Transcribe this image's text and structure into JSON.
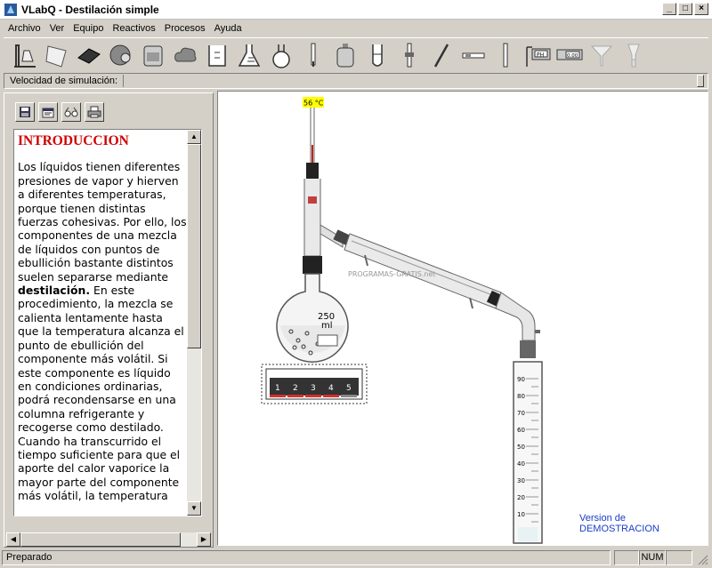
{
  "window": {
    "title": "VLabQ - Destilación simple"
  },
  "menu": [
    "Archivo",
    "Ver",
    "Equipo",
    "Reactivos",
    "Procesos",
    "Ayuda"
  ],
  "toolbar": {
    "tools": [
      "flask-stand-icon",
      "burette-tool-icon",
      "plate-icon",
      "heater-icon",
      "beaker-stack-icon",
      "cloud-icon",
      "beaker-icon",
      "erlenmeyer-icon",
      "round-flask-icon",
      "thermometer-icon",
      "bottle-icon",
      "test-tube-icon",
      "stopcock-icon",
      "rod-icon",
      "pipette-icon",
      "tube-icon",
      "ph-meter-icon",
      "balance-icon",
      "funnel-icon",
      "separatory-funnel-icon"
    ],
    "ph_label": "PH",
    "balance_label": "0.00"
  },
  "speed": {
    "label": "Velocidad de simulación:"
  },
  "left_tools": [
    "save-icon",
    "properties-icon",
    "glasses-icon",
    "print-icon"
  ],
  "intro": {
    "heading": "INTRODUCCION",
    "text_before_bold": "Los líquidos tienen diferentes presiones de vapor y hierven a diferentes temperaturas, porque tienen distintas fuerzas cohesivas. Por ello, los componentes de una mezcla de líquidos con puntos de ebullición bastante distintos suelen separarse mediante ",
    "bold": "destilación.",
    "text_after_bold": " En este procedimiento, la mezcla se calienta lentamente hasta que la temperatura alcanza el punto de ebullición del componente más volátil. Si este componente es líquido en condiciones ordinarias, podrá recondensarse en una columna refrigerante y recogerse como destilado. Cuando ha transcurrido el tiempo suficiente para que el aporte del calor vaporice la mayor parte del componente más volátil, la temperatura"
  },
  "apparatus": {
    "temperature": "56 °C",
    "flask_volume": "250",
    "flask_unit": "ml",
    "heater_levels": [
      "1",
      "2",
      "3",
      "4",
      "5"
    ],
    "cylinder_ticks": [
      "90",
      "80",
      "70",
      "60",
      "50",
      "40",
      "30",
      "20",
      "10"
    ],
    "watermark": "PROGRAMAS-GRATIS.net"
  },
  "demo_notice": "Version de DEMOSTRACION",
  "status": {
    "text": "Preparado",
    "num": "NUM"
  },
  "colors": {
    "heading": "#d00000",
    "demo": "#1a3cc8",
    "thermo_label_bg": "#ffff00",
    "heater_red": "#d03030"
  }
}
